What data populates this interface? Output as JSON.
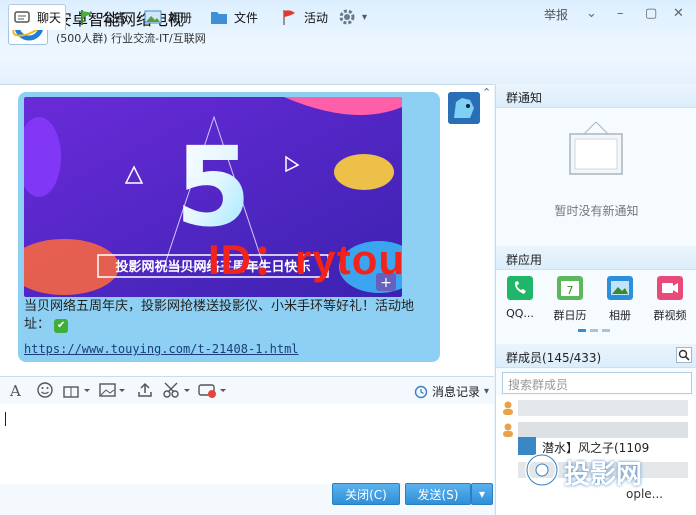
{
  "window": {
    "title": "安卓智能网络电视",
    "subtitle": "(500人群) 行业交流-IT/互联网",
    "report_label": "举报",
    "ctrl_dropdown": "⌄",
    "ctrl_minimize": "–",
    "ctrl_maximize": "▢",
    "ctrl_close": "✕"
  },
  "toolbar": {
    "tabs": [
      "聊天",
      "公告",
      "相册",
      "文件",
      "活动"
    ],
    "gear_dropdown": "▾"
  },
  "message": {
    "banner_text": "投影网祝当贝网络五周年生日快乐",
    "banner_digit": "5",
    "text": "当贝网络五周年庆，投影网抢楼送投影仪、小米手环等好礼！活动地址：",
    "link": "https://www.touying.com/t-21408-1.html",
    "plus_glyph": "+",
    "scroll_up": "⌃"
  },
  "overlay": {
    "id_text": "ID：rytou",
    "logo_text": "投影网"
  },
  "input": {
    "font_icon_label": "A",
    "history_label": "消息记录",
    "history_dropdown": "▾",
    "close_button": "关闭(C)",
    "send_button": "发送(S)",
    "send_dropdown": "▾"
  },
  "right": {
    "notice_header": "群通知",
    "no_notice": "暂时没有新通知",
    "apps_header": "群应用",
    "apps": [
      "QQ...",
      "群日历",
      "相册",
      "群视频"
    ],
    "calendar_day": "7",
    "members_header": "群成员(145/433)",
    "search_placeholder": "搜索群成员",
    "member_visible": "潜水】风之子(1109",
    "member_fragment": "ople..."
  }
}
